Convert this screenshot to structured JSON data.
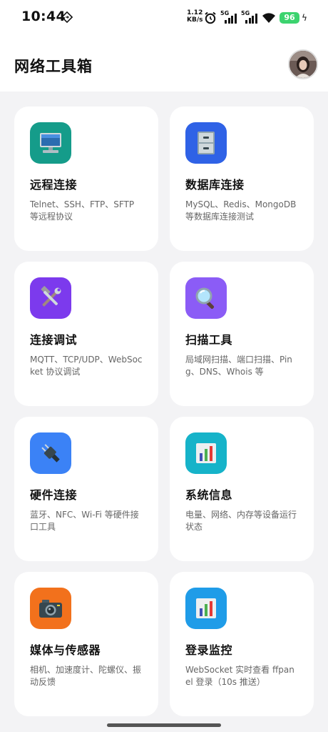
{
  "status_bar": {
    "time": "10:44",
    "net_speed_value": "1.12",
    "net_speed_unit": "KB/s",
    "sim1_label": "5G",
    "sim2_label": "5G",
    "battery": "96",
    "icons": [
      "sync-icon",
      "alarm-icon",
      "signal-icon",
      "signal-icon",
      "wifi-icon",
      "battery-icon",
      "charging-icon"
    ]
  },
  "header": {
    "title": "网络工具箱",
    "avatar_icon": "avatar"
  },
  "tools": [
    {
      "title": "远程连接",
      "description": "Telnet、SSH、FTP、SFTP 等远程协议",
      "icon": "desktop-computer-icon",
      "color": "#159c8a"
    },
    {
      "title": "数据库连接",
      "description": "MySQL、Redis、MongoDB 等数据库连接测试",
      "icon": "file-cabinet-icon",
      "color": "#2f62e6"
    },
    {
      "title": "连接调试",
      "description": "MQTT、TCP/UDP、WebSocket 协议调试",
      "icon": "hammer-wrench-icon",
      "color": "#7c3aed"
    },
    {
      "title": "扫描工具",
      "description": "局域网扫描、端口扫描、Ping、DNS、Whois 等",
      "icon": "magnifier-icon",
      "color": "#8b5cf6"
    },
    {
      "title": "硬件连接",
      "description": "蓝牙、NFC、Wi-Fi 等硬件接口工具",
      "icon": "plug-icon",
      "color": "#3b82f6"
    },
    {
      "title": "系统信息",
      "description": "电量、网络、内存等设备运行状态",
      "icon": "bar-chart-icon",
      "color": "#16b3c9"
    },
    {
      "title": "媒体与传感器",
      "description": "相机、加速度计、陀螺仪、振动反馈",
      "icon": "camera-icon",
      "color": "#f2711c"
    },
    {
      "title": "登录监控",
      "description": "WebSocket 实时查看 ffpanel 登录（10s 推送）",
      "icon": "bar-chart-icon",
      "color": "#1f9ce8"
    }
  ]
}
